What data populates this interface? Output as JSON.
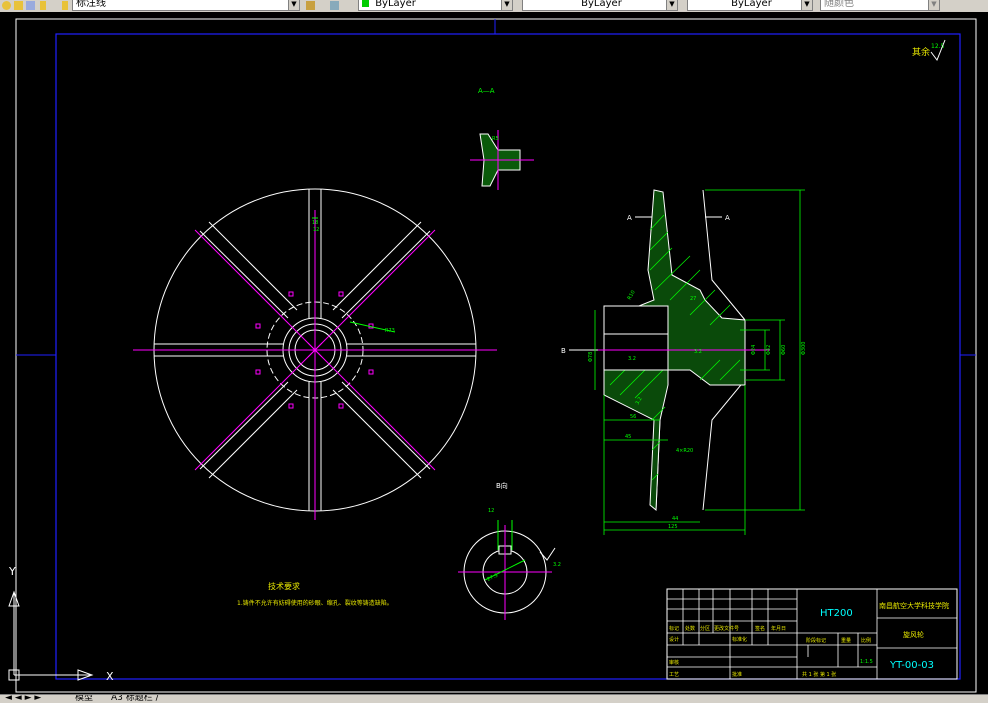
{
  "toolbar": {
    "linetype_label": "标注线",
    "color_control": "ByLayer",
    "linetype_control": "ByLayer",
    "lineweight_control": "ByLayer",
    "plotstyle_control": "随颜色"
  },
  "drawing": {
    "roughness_note": "其余",
    "roughness_value": "12.5",
    "section_aa_title": "A—A",
    "section_b_title": "B向",
    "section_a_left": "A",
    "section_a_right": "A",
    "view_b_label": "B",
    "dim_hole_r": "R73",
    "dim_top_18": "18",
    "dim_top_12": "12",
    "dim_phi300": "Φ300",
    "dim_phi60": "Φ60",
    "dim_phi42": "Φ42",
    "dim_phi24": "Φ24",
    "dim_phi78": "Φ78",
    "dim_56": "56",
    "dim_45": "45",
    "dim_44": "44",
    "dim_125": "125",
    "dim_r20": "4×R20",
    "dim_r5": "R5",
    "dim_r10": "R10",
    "dim_27": "27",
    "rough_32_a": "3.2",
    "rough_32_b": "3.2",
    "rough_32_c": "3.2",
    "rough_32_d": "3.2",
    "rough_32_e": "3.2",
    "keyway_12": "12",
    "keyway_27": "27.3",
    "tech_title": "技术要求",
    "tech_line1": "1.铸件不允许有妨碍使用的砂眼、缩孔、裂纹等铸造缺陷。"
  },
  "title_block": {
    "material": "HT200",
    "school": "南昌航空大学科技学院",
    "part_name": "旋风轮",
    "drawing_no": "YT-00-03",
    "row_headers": [
      "标记",
      "处数",
      "分区",
      "更改文件号",
      "签名",
      "年月日"
    ],
    "designer_label": "设计",
    "std_label": "标准化",
    "check_label": "审核",
    "process_label": "工艺",
    "approve_label": "批准",
    "stage_label": "阶段标记",
    "weight_label": "重量",
    "scale_label": "比例",
    "scale_value": "1:1.5",
    "sheet_info": "共 1 张  第 1 张"
  },
  "ucs": {
    "x_label": "X",
    "y_label": "Y"
  },
  "tabs": {
    "model": "模型",
    "layout1": "A3 标题栏 /"
  }
}
